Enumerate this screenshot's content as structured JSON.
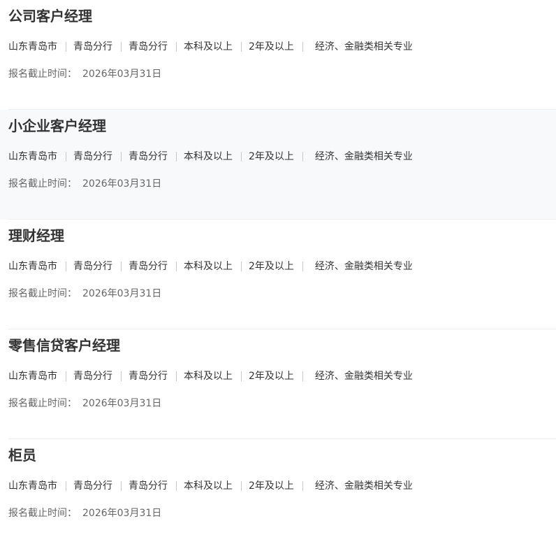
{
  "jobs": [
    {
      "title": "公司客户经理",
      "location": "山东青岛市",
      "branch": "青岛分行",
      "dept": "青岛分行",
      "education": "本科及以上",
      "experience": "2年及以上",
      "major": "经济、金融类相关专业",
      "deadline_label": "报名截止时间：",
      "deadline": "2026年03月31日"
    },
    {
      "title": "小企业客户经理",
      "location": "山东青岛市",
      "branch": "青岛分行",
      "dept": "青岛分行",
      "education": "本科及以上",
      "experience": "2年及以上",
      "major": "经济、金融类相关专业",
      "deadline_label": "报名截止时间：",
      "deadline": "2026年03月31日"
    },
    {
      "title": "理财经理",
      "location": "山东青岛市",
      "branch": "青岛分行",
      "dept": "青岛分行",
      "education": "本科及以上",
      "experience": "2年及以上",
      "major": "经济、金融类相关专业",
      "deadline_label": "报名截止时间：",
      "deadline": "2026年03月31日"
    },
    {
      "title": "零售信贷客户经理",
      "location": "山东青岛市",
      "branch": "青岛分行",
      "dept": "青岛分行",
      "education": "本科及以上",
      "experience": "2年及以上",
      "major": "经济、金融类相关专业",
      "deadline_label": "报名截止时间：",
      "deadline": "2026年03月31日"
    },
    {
      "title": "柜员",
      "location": "山东青岛市",
      "branch": "青岛分行",
      "dept": "青岛分行",
      "education": "本科及以上",
      "experience": "2年及以上",
      "major": "经济、金融类相关专业",
      "deadline_label": "报名截止时间：",
      "deadline": "2026年03月31日"
    }
  ]
}
